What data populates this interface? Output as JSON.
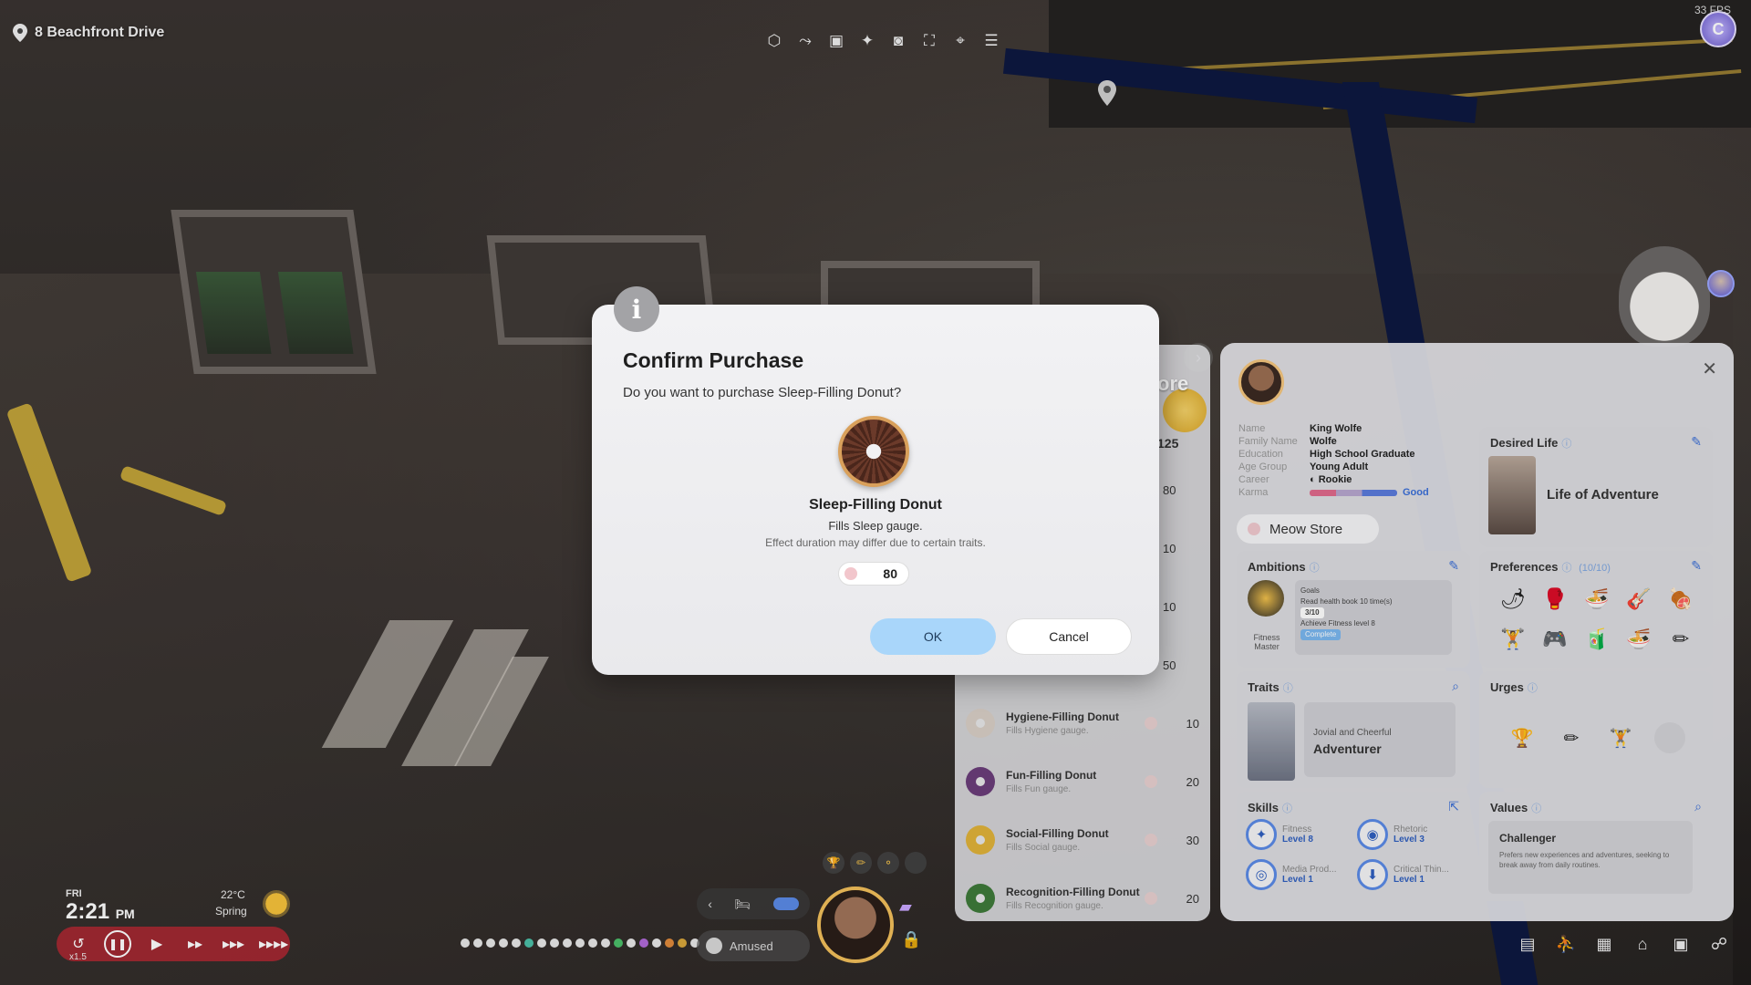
{
  "location": {
    "name": "8 Beachfront Drive",
    "icon": "map-pin-icon"
  },
  "fps": "33 FPS",
  "top_avatar_letter": "C",
  "toolbar": {
    "icons": [
      "lot-icon",
      "path-icon",
      "camera-mode-icon",
      "sparkle-icon",
      "screenshot-icon",
      "expand-icon",
      "focus-icon",
      "menu-icon"
    ]
  },
  "modal": {
    "info_glyph": "i",
    "title": "Confirm Purchase",
    "question": "Do you want to purchase Sleep-Filling Donut?",
    "item_name": "Sleep-Filling Donut",
    "item_desc": "Fills Sleep gauge.",
    "item_note": "Effect duration may differ due to certain traits.",
    "price": "80",
    "ok_label": "OK",
    "cancel_label": "Cancel"
  },
  "store": {
    "header_text": "ore",
    "balance": "125",
    "rows": [
      {
        "price": "80"
      },
      {
        "price": "10"
      },
      {
        "price": "10"
      },
      {
        "price": "50"
      },
      {
        "name": "Hygiene-Filling Donut",
        "desc": "Fills Hygiene gauge.",
        "price": "10",
        "color": "#d8cfc6"
      },
      {
        "name": "Fun-Filling Donut",
        "desc": "Fills Fun gauge.",
        "price": "20",
        "color": "#6b3d7a"
      },
      {
        "name": "Social-Filling Donut",
        "desc": "Fills Social gauge.",
        "price": "30",
        "color": "#e0b23a"
      },
      {
        "name": "Recognition-Filling Donut",
        "desc": "Fills Recognition gauge.",
        "price": "20",
        "color": "#3e7a3a"
      }
    ]
  },
  "profile": {
    "name_label": "Name",
    "name": "King Wolfe",
    "family_label": "Family Name",
    "family": "Wolfe",
    "education_label": "Education",
    "education": "High School Graduate",
    "age_label": "Age Group",
    "age": "Young Adult",
    "career_label": "Career",
    "career": "Rookie",
    "karma_label": "Karma",
    "karma": "Good",
    "meow_store": "Meow Store",
    "desired_life_title": "Desired Life",
    "desired_life": "Life of Adventure",
    "ambitions_title": "Ambitions",
    "ambition_name": "Fitness Master",
    "goals_label": "Goals",
    "goal1": "Read health book 10 time(s)",
    "goal1_progress": "3/10",
    "goal2": "Achieve Fitness level 8",
    "goal2_status": "Complete",
    "preferences_title": "Preferences",
    "preferences_count": "(10/10)",
    "preference_icons": [
      "🌶",
      "🥊",
      "🍜",
      "🎸",
      "🍖",
      "🏋",
      "🎮",
      "🧃",
      "🍜",
      "✏"
    ],
    "traits_title": "Traits",
    "trait_sub": "Jovial and Cheerful",
    "trait_name": "Adventurer",
    "urges_title": "Urges",
    "skills_title": "Skills",
    "skills": [
      {
        "name": "Fitness",
        "level": "Level 8"
      },
      {
        "name": "Rhetoric",
        "level": "Level 3"
      },
      {
        "name": "Media Prod...",
        "level": "Level 1"
      },
      {
        "name": "Critical Thin...",
        "level": "Level 1"
      }
    ],
    "values_title": "Values",
    "value_name": "Challenger",
    "value_desc": "Prefers new experiences and adventures, seeking to break away from daily routines."
  },
  "time": {
    "day": "FRI",
    "clock": "2:21",
    "ampm": "PM",
    "temperature": "22°C",
    "season": "Spring",
    "speed_multiplier": "x1.5"
  },
  "mood": "Amused",
  "colors": {
    "accent_blue": "#a9d6fa",
    "speed_bar": "#b42832",
    "portrait_ring": "#f2bf5b"
  }
}
